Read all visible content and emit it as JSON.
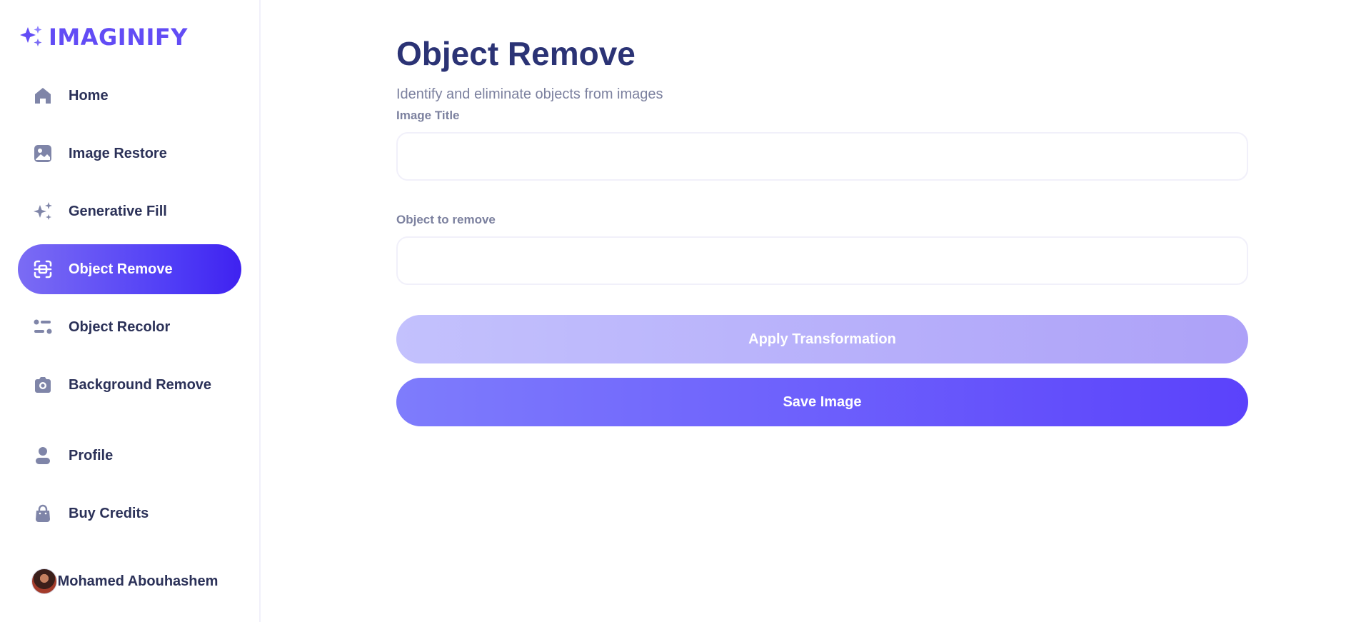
{
  "app": {
    "logo_text": "IMAGINIFY"
  },
  "sidebar": {
    "items": [
      {
        "label": "Home",
        "icon": "home-icon"
      },
      {
        "label": "Image Restore",
        "icon": "image-icon"
      },
      {
        "label": "Generative Fill",
        "icon": "sparkles-icon"
      },
      {
        "label": "Object Remove",
        "icon": "scan-icon",
        "active": true
      },
      {
        "label": "Object Recolor",
        "icon": "filter-icon"
      },
      {
        "label": "Background Remove",
        "icon": "camera-icon"
      }
    ],
    "bottom_items": [
      {
        "label": "Profile",
        "icon": "user-icon"
      },
      {
        "label": "Buy Credits",
        "icon": "bag-icon"
      }
    ],
    "user": {
      "name": "Mohamed Abouhashem"
    }
  },
  "main": {
    "title": "Object Remove",
    "subtitle": "Identify and eliminate objects from images",
    "fields": {
      "image_title": {
        "label": "Image Title",
        "value": "",
        "placeholder": ""
      },
      "object_to_remove": {
        "label": "Object to remove",
        "value": "",
        "placeholder": ""
      }
    },
    "buttons": {
      "apply": "Apply Transformation",
      "save": "Save Image"
    }
  },
  "colors": {
    "accent": "#624cf5",
    "active_nav_start": "#7b6cf4",
    "active_nav_end": "#3f22f0",
    "title": "#2b3375",
    "muted_text": "#7c819f",
    "icon_gray": "#7f85a8",
    "apply_button": "#c3c1fd",
    "save_button": "#5b42fb"
  }
}
